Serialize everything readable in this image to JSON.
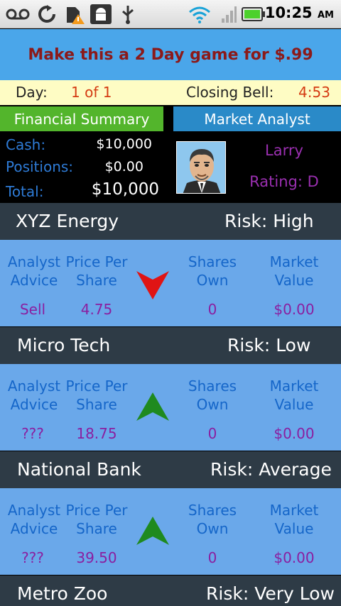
{
  "status": {
    "time": "10:25",
    "ampm": "AM",
    "icons": [
      "voicemail-icon",
      "sync-icon",
      "sd-card-warning-icon",
      "android-debug-icon",
      "usb-icon",
      "wifi-icon",
      "signal-icon",
      "battery-icon"
    ]
  },
  "promo": {
    "text": "Make this a 2 Day game for $.99"
  },
  "day": {
    "label": "Day:",
    "value": "1 of 1",
    "closing_label": "Closing Bell:",
    "closing_value": "4:53"
  },
  "tabs": {
    "financial": "Financial Summary",
    "analyst": "Market Analyst"
  },
  "summary": {
    "cash_label": "Cash:",
    "cash_value": "$10,000",
    "positions_label": "Positions:",
    "positions_value": "$0.00",
    "total_label": "Total:",
    "total_value": "$10,000"
  },
  "analyst": {
    "name": "Larry",
    "rating": "Rating: D"
  },
  "columns": {
    "advice": [
      "Analyst",
      "Advice"
    ],
    "price": [
      "Price Per",
      "Share"
    ],
    "shares": [
      "Shares",
      "Own"
    ],
    "market": [
      "Market",
      "Value"
    ]
  },
  "stocks": [
    {
      "name": "XYZ Energy",
      "risk": "Risk:  High",
      "advice": "Sell",
      "price": "4.75",
      "shares": "0",
      "value": "$0.00",
      "trend": "down"
    },
    {
      "name": "Micro Tech",
      "risk": "Risk:  Low",
      "advice": "???",
      "price": "18.75",
      "shares": "0",
      "value": "$0.00",
      "trend": "up"
    },
    {
      "name": "National Bank",
      "risk": "Risk:  Average",
      "advice": "???",
      "price": "39.50",
      "shares": "0",
      "value": "$0.00",
      "trend": "up"
    },
    {
      "name": "Metro Zoo",
      "risk": "Risk:  Very Low"
    }
  ],
  "colors": {
    "up": "#1f8a1f",
    "down": "#e01414",
    "promo_bg": "#4aa6ea",
    "header_bg": "#2e3b46"
  }
}
